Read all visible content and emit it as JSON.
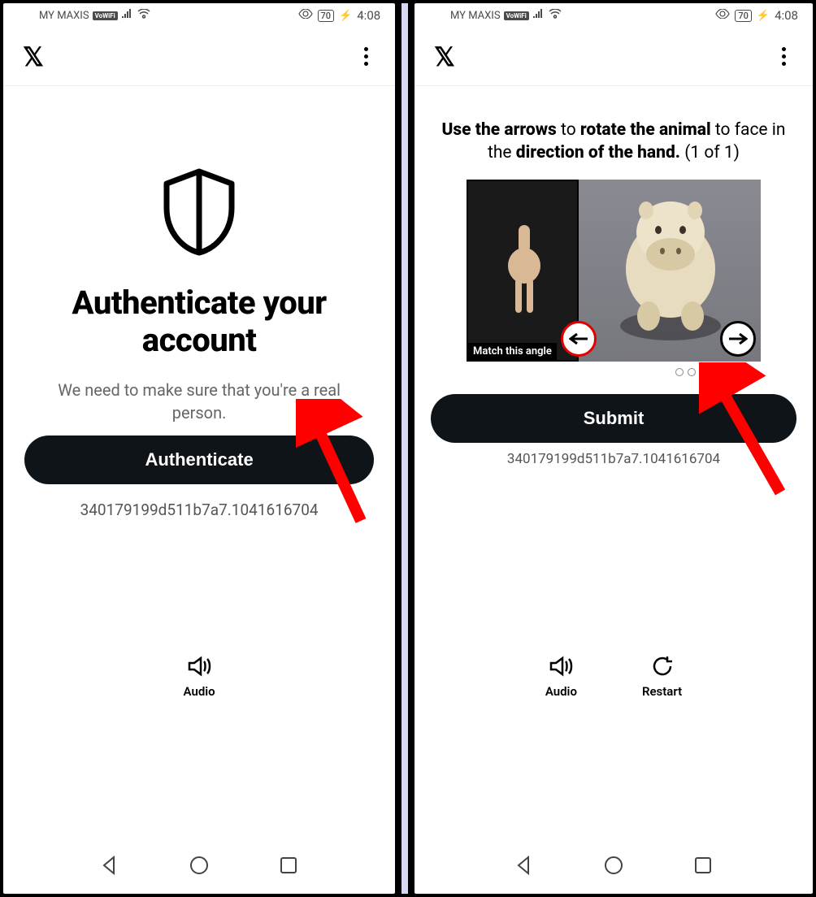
{
  "status": {
    "carrier": "MY MAXIS",
    "vowifi": "VoWiFi",
    "battery": "70",
    "time": "4:08"
  },
  "left": {
    "title": "Authenticate your account",
    "subtitle": "We need to make sure that you're a real person.",
    "button": "Authenticate",
    "hash": "340179199d511b7a7.1041616704",
    "audio": "Audio"
  },
  "right": {
    "instruction_pre": "Use the arrows",
    "instruction_mid1": " to ",
    "instruction_bold2": "rotate the animal",
    "instruction_mid2": " to face in the ",
    "instruction_bold3": "direction of the hand.",
    "instruction_count": " (1 of 1)",
    "ref_label": "Match this angle",
    "submit": "Submit",
    "hash": "340179199d511b7a7.1041616704",
    "audio": "Audio",
    "restart": "Restart"
  }
}
